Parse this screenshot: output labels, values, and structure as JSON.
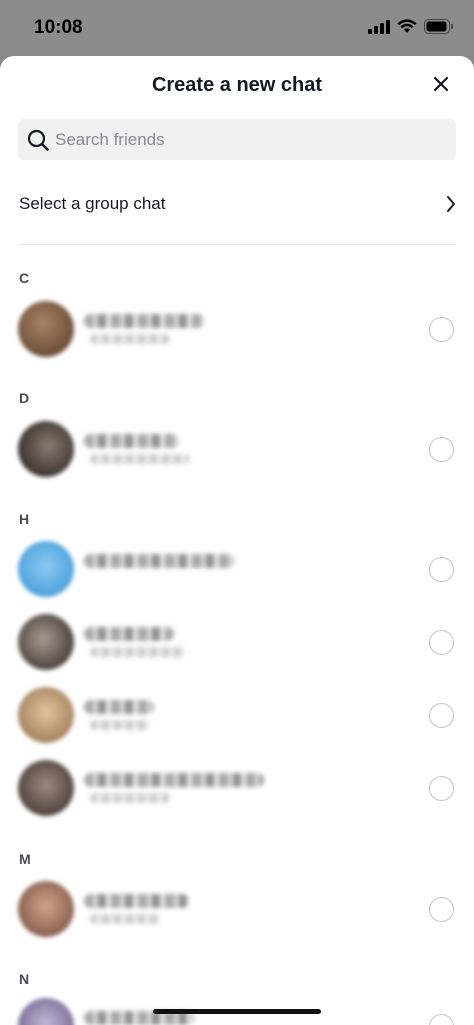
{
  "status_bar": {
    "time": "10:08"
  },
  "sheet": {
    "title": "Create a new chat",
    "search_placeholder": "Search friends",
    "group_chat_label": "Select a group chat"
  },
  "sections": [
    {
      "letter": "C"
    },
    {
      "letter": "D"
    },
    {
      "letter": "H"
    },
    {
      "letter": "M"
    },
    {
      "letter": "N"
    }
  ],
  "avatar_colors": [
    "#8b6a4f",
    "#5e4f48",
    "#6ab5e8",
    "#7a6a5e",
    "#c9a77c",
    "#7d6a63",
    "#b08870",
    "#9a8fb0"
  ]
}
